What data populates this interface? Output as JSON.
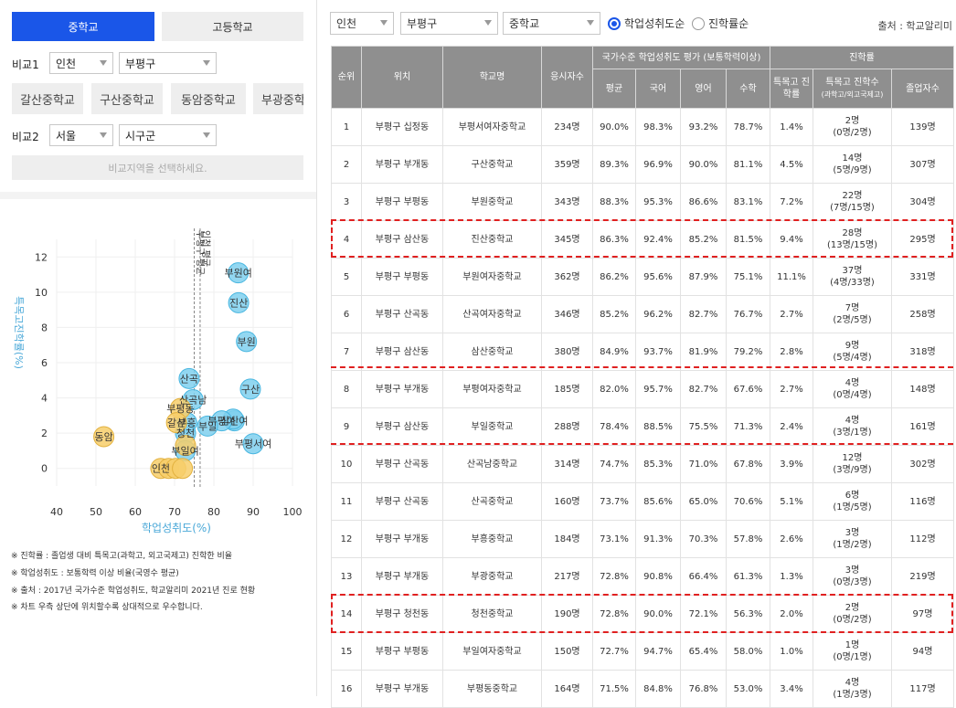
{
  "tabs": {
    "middle": "중학교",
    "high": "고등학교"
  },
  "compare1": {
    "label": "비교1",
    "region": "인천",
    "district": "부평구",
    "chips": [
      "갈산중학교",
      "구산중학교",
      "동암중학교",
      "부광중학교"
    ]
  },
  "compare2": {
    "label": "비교2",
    "region": "서울",
    "district": "시구군",
    "button": "비교지역을 선택하세요."
  },
  "filters": {
    "region": "인천",
    "district": "부평구",
    "level": "중학교",
    "sort_options": [
      "학업성취도순",
      "진학률순"
    ],
    "source": "출처 : 학교알리미"
  },
  "chart_data": {
    "type": "scatter",
    "xlabel": "학업성취도(%)",
    "ylabel": "특목고진학률(%)",
    "xlim": [
      40,
      100
    ],
    "ylim": [
      -1,
      13
    ],
    "xticks": [
      40,
      50,
      60,
      70,
      80,
      90,
      100
    ],
    "yticks": [
      0,
      2,
      4,
      6,
      8,
      10,
      12
    ],
    "colors": {
      "blue": "#7fd0ee",
      "yellow": "#f7ce6a",
      "stroke_blue": "#48b6e0",
      "stroke_yellow": "#e2b13e"
    },
    "points": [
      {
        "x": 86.2,
        "y": 11.1,
        "label": "부원여",
        "color": "blue"
      },
      {
        "x": 86.3,
        "y": 9.4,
        "label": "진산",
        "color": "blue"
      },
      {
        "x": 88.3,
        "y": 7.2,
        "label": "부원",
        "color": "blue"
      },
      {
        "x": 89.3,
        "y": 4.5,
        "label": "구산",
        "color": "blue"
      },
      {
        "x": 85.2,
        "y": 2.7,
        "label": "삼산여",
        "color": "blue"
      },
      {
        "x": 84.9,
        "y": 2.8,
        "label": "",
        "color": "blue"
      },
      {
        "x": 82.0,
        "y": 2.7,
        "label": "부평여",
        "color": "blue"
      },
      {
        "x": 78.4,
        "y": 2.4,
        "label": "부일",
        "color": "blue"
      },
      {
        "x": 90.0,
        "y": 1.4,
        "label": "부평서여",
        "color": "blue"
      },
      {
        "x": 74.7,
        "y": 3.9,
        "label": "산곡남",
        "color": "blue"
      },
      {
        "x": 73.7,
        "y": 5.1,
        "label": "산곡",
        "color": "blue"
      },
      {
        "x": 73.1,
        "y": 2.6,
        "label": "부흥",
        "color": "blue"
      },
      {
        "x": 72.8,
        "y": 2.0,
        "label": "청천",
        "color": "blue"
      },
      {
        "x": 72.7,
        "y": 1.0,
        "label": "부일여",
        "color": "blue"
      },
      {
        "x": 72.8,
        "y": 1.3,
        "label": "",
        "color": "yellow"
      },
      {
        "x": 71.5,
        "y": 3.4,
        "label": "부평동",
        "color": "yellow"
      },
      {
        "x": 70.5,
        "y": 2.6,
        "label": "갈산",
        "color": "yellow"
      },
      {
        "x": 52.0,
        "y": 1.8,
        "label": "동암",
        "color": "yellow"
      },
      {
        "x": 66.5,
        "y": 0.0,
        "label": "인천",
        "color": "yellow"
      },
      {
        "x": 68.5,
        "y": 0.0,
        "label": "",
        "color": "yellow"
      },
      {
        "x": 70.3,
        "y": 0.0,
        "label": "",
        "color": "yellow"
      },
      {
        "x": 72.0,
        "y": 0.0,
        "label": "",
        "color": "yellow"
      }
    ],
    "ref_lines": [
      {
        "x": 75.0,
        "label": "부평구 평균"
      },
      {
        "x": 76.5,
        "label": "인천 평균"
      }
    ]
  },
  "notes": [
    "※ 진학률 : 졸업생 대비 특목고(과학고, 외고국제고) 진학한 비율",
    "※ 학업성취도 : 보통학력 이상 비율(국영수 평균)",
    "※ 출처 : 2017년 국가수준 학업성취도, 학교알리미 2021년 진로 현황",
    "※ 차트 우측 상단에 위치할수록 상대적으로 우수합니다."
  ],
  "table": {
    "headers": {
      "rank": "순위",
      "location": "위치",
      "school": "학교명",
      "takers": "응시자수",
      "achievement": "국가수준 학업성취도 평가 (보통학력이상)",
      "avg": "평균",
      "kor": "국어",
      "eng": "영어",
      "math": "수학",
      "advance": "진학률",
      "special_rate": "특목고 진학률",
      "special_count": "특목고 진학수",
      "special_count_sub": "(과학고/외고국제고)",
      "grads": "졸업자수"
    },
    "rows": [
      {
        "rank": "1",
        "loc": "부평구 십정동",
        "name": "부평서여자중학교",
        "takers": "234명",
        "avg": "90.0%",
        "kor": "98.3%",
        "eng": "93.2%",
        "math": "78.7%",
        "rate": "1.4%",
        "cnt": "2명",
        "cnt2": "(0명/2명)",
        "grads": "139명"
      },
      {
        "rank": "2",
        "loc": "부평구 부개동",
        "name": "구산중학교",
        "takers": "359명",
        "avg": "89.3%",
        "kor": "96.9%",
        "eng": "90.0%",
        "math": "81.1%",
        "rate": "4.5%",
        "cnt": "14명",
        "cnt2": "(5명/9명)",
        "grads": "307명"
      },
      {
        "rank": "3",
        "loc": "부평구 부평동",
        "name": "부원중학교",
        "takers": "343명",
        "avg": "88.3%",
        "kor": "95.3%",
        "eng": "86.6%",
        "math": "83.1%",
        "rate": "7.2%",
        "cnt": "22명",
        "cnt2": "(7명/15명)",
        "grads": "304명"
      },
      {
        "rank": "4",
        "loc": "부평구 삼산동",
        "name": "진산중학교",
        "takers": "345명",
        "avg": "86.3%",
        "kor": "92.4%",
        "eng": "85.2%",
        "math": "81.5%",
        "rate": "9.4%",
        "cnt": "28명",
        "cnt2": "(13명/15명)",
        "grads": "295명"
      },
      {
        "rank": "5",
        "loc": "부평구 부평동",
        "name": "부원여자중학교",
        "takers": "362명",
        "avg": "86.2%",
        "kor": "95.6%",
        "eng": "87.9%",
        "math": "75.1%",
        "rate": "11.1%",
        "cnt": "37명",
        "cnt2": "(4명/33명)",
        "grads": "331명"
      },
      {
        "rank": "6",
        "loc": "부평구 산곡동",
        "name": "산곡여자중학교",
        "takers": "346명",
        "avg": "85.2%",
        "kor": "96.2%",
        "eng": "82.7%",
        "math": "76.7%",
        "rate": "2.7%",
        "cnt": "7명",
        "cnt2": "(2명/5명)",
        "grads": "258명"
      },
      {
        "rank": "7",
        "loc": "부평구 삼산동",
        "name": "삼산중학교",
        "takers": "380명",
        "avg": "84.9%",
        "kor": "93.7%",
        "eng": "81.9%",
        "math": "79.2%",
        "rate": "2.8%",
        "cnt": "9명",
        "cnt2": "(5명/4명)",
        "grads": "318명"
      },
      {
        "rank": "8",
        "loc": "부평구 부개동",
        "name": "부평여자중학교",
        "takers": "185명",
        "avg": "82.0%",
        "kor": "95.7%",
        "eng": "82.7%",
        "math": "67.6%",
        "rate": "2.7%",
        "cnt": "4명",
        "cnt2": "(0명/4명)",
        "grads": "148명"
      },
      {
        "rank": "9",
        "loc": "부평구 삼산동",
        "name": "부일중학교",
        "takers": "288명",
        "avg": "78.4%",
        "kor": "88.5%",
        "eng": "75.5%",
        "math": "71.3%",
        "rate": "2.4%",
        "cnt": "4명",
        "cnt2": "(3명/1명)",
        "grads": "161명"
      },
      {
        "rank": "10",
        "loc": "부평구 산곡동",
        "name": "산곡남중학교",
        "takers": "314명",
        "avg": "74.7%",
        "kor": "85.3%",
        "eng": "71.0%",
        "math": "67.8%",
        "rate": "3.9%",
        "cnt": "12명",
        "cnt2": "(3명/9명)",
        "grads": "302명"
      },
      {
        "rank": "11",
        "loc": "부평구 산곡동",
        "name": "산곡중학교",
        "takers": "160명",
        "avg": "73.7%",
        "kor": "85.6%",
        "eng": "65.0%",
        "math": "70.6%",
        "rate": "5.1%",
        "cnt": "6명",
        "cnt2": "(1명/5명)",
        "grads": "116명"
      },
      {
        "rank": "12",
        "loc": "부평구 부개동",
        "name": "부흥중학교",
        "takers": "184명",
        "avg": "73.1%",
        "kor": "91.3%",
        "eng": "70.3%",
        "math": "57.8%",
        "rate": "2.6%",
        "cnt": "3명",
        "cnt2": "(1명/2명)",
        "grads": "112명"
      },
      {
        "rank": "13",
        "loc": "부평구 부개동",
        "name": "부광중학교",
        "takers": "217명",
        "avg": "72.8%",
        "kor": "90.8%",
        "eng": "66.4%",
        "math": "61.3%",
        "rate": "1.3%",
        "cnt": "3명",
        "cnt2": "(0명/3명)",
        "grads": "219명"
      },
      {
        "rank": "14",
        "loc": "부평구 청천동",
        "name": "청천중학교",
        "takers": "190명",
        "avg": "72.8%",
        "kor": "90.0%",
        "eng": "72.1%",
        "math": "56.3%",
        "rate": "2.0%",
        "cnt": "2명",
        "cnt2": "(0명/2명)",
        "grads": "97명"
      },
      {
        "rank": "15",
        "loc": "부평구 부평동",
        "name": "부일여자중학교",
        "takers": "150명",
        "avg": "72.7%",
        "kor": "94.7%",
        "eng": "65.4%",
        "math": "58.0%",
        "rate": "1.0%",
        "cnt": "1명",
        "cnt2": "(0명/1명)",
        "grads": "94명"
      },
      {
        "rank": "16",
        "loc": "부평구 부개동",
        "name": "부평동중학교",
        "takers": "164명",
        "avg": "71.5%",
        "kor": "84.8%",
        "eng": "76.8%",
        "math": "53.0%",
        "rate": "3.4%",
        "cnt": "4명",
        "cnt2": "(1명/3명)",
        "grads": "117명"
      }
    ]
  }
}
